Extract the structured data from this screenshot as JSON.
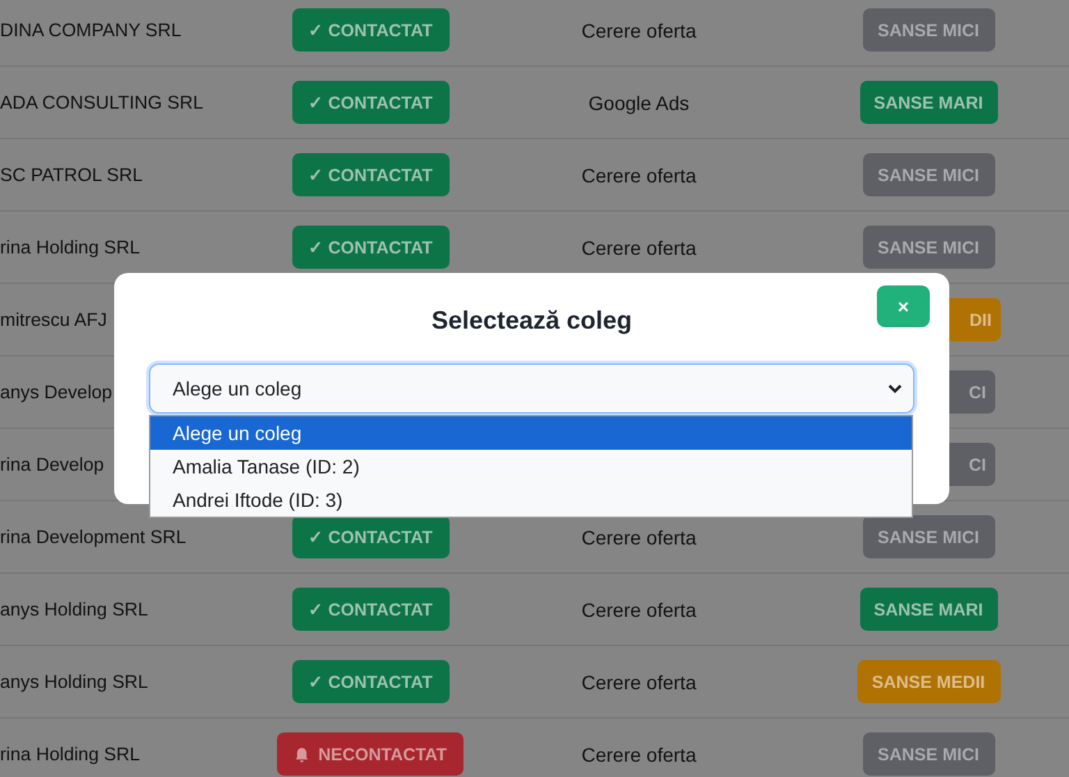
{
  "table": {
    "rows": [
      {
        "company": "DINA COMPANY SRL",
        "status": {
          "kind": "contacted",
          "label": "✓ CONTACTAT"
        },
        "source": "Cerere oferta",
        "chance": {
          "kind": "low",
          "label": "SANSE MICI",
          "covered": false
        }
      },
      {
        "company": "ADA CONSULTING SRL",
        "status": {
          "kind": "contacted",
          "label": "✓ CONTACTAT"
        },
        "source": "Google Ads",
        "chance": {
          "kind": "high",
          "label": "SANSE MARI",
          "covered": false
        }
      },
      {
        "company": "SC PATROL SRL",
        "status": {
          "kind": "contacted",
          "label": "✓ CONTACTAT"
        },
        "source": "Cerere oferta",
        "chance": {
          "kind": "low",
          "label": "SANSE MICI",
          "covered": false
        }
      },
      {
        "company": "rina Holding SRL",
        "status": {
          "kind": "contacted",
          "label": "✓ CONTACTAT"
        },
        "source": "Cerere oferta",
        "chance": {
          "kind": "low",
          "label": "SANSE MICI",
          "covered": false
        }
      },
      {
        "company": "mitrescu AFJ",
        "chance": {
          "kind": "medium",
          "label": "DII",
          "covered": true
        }
      },
      {
        "company": "anys Develop",
        "chance": {
          "kind": "low",
          "label": "CI",
          "covered": true
        }
      },
      {
        "company": "rina Develop",
        "chance": {
          "kind": "low",
          "label": "CI",
          "covered": true
        }
      },
      {
        "company": "rina Development SRL",
        "status": {
          "kind": "contacted",
          "label": "✓ CONTACTAT"
        },
        "source": "Cerere oferta",
        "chance": {
          "kind": "low",
          "label": "SANSE MICI",
          "covered": false
        }
      },
      {
        "company": "anys Holding SRL",
        "status": {
          "kind": "contacted",
          "label": "✓ CONTACTAT"
        },
        "source": "Cerere oferta",
        "chance": {
          "kind": "high",
          "label": "SANSE MARI",
          "covered": false
        }
      },
      {
        "company": "anys Holding SRL",
        "status": {
          "kind": "contacted",
          "label": "✓ CONTACTAT"
        },
        "source": "Cerere oferta",
        "chance": {
          "kind": "medium",
          "label": "SANSE MEDII",
          "covered": false
        }
      },
      {
        "company": "rina Holding SRL",
        "status": {
          "kind": "not_contacted",
          "label": "NECONTACTAT"
        },
        "source": "Cerere oferta",
        "chance": {
          "kind": "low",
          "label": "SANSE MICI",
          "covered": false
        }
      }
    ]
  },
  "modal": {
    "title": "Selectează coleg",
    "close": "×",
    "select": {
      "value": "Alege un coleg",
      "expanded": true,
      "options": [
        {
          "label": "Alege un coleg",
          "selected": true
        },
        {
          "label": "Amalia Tanase (ID: 2)",
          "selected": false
        },
        {
          "label": "Andrei Iftode (ID: 3)",
          "selected": false
        }
      ]
    }
  }
}
